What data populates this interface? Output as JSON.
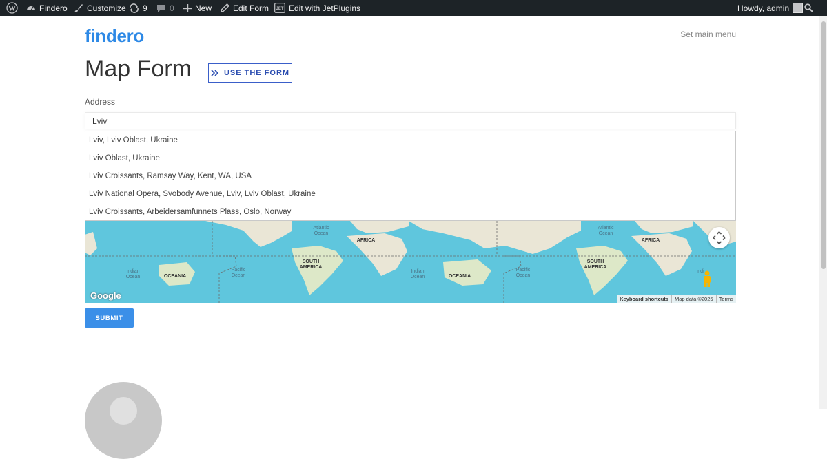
{
  "adminbar": {
    "site_name": "Findero",
    "customize": "Customize",
    "updates_count": "9",
    "comments_count": "0",
    "new_label": "New",
    "edit_form": "Edit Form",
    "jetplugins": "Edit with JetPlugins",
    "greeting": "Howdy, admin"
  },
  "header": {
    "logo": "findero",
    "menu": "Set main menu"
  },
  "page": {
    "title": "Map Form",
    "use_form_button": "USE THE FORM"
  },
  "form": {
    "address_label": "Address",
    "address_value": "Lviv",
    "suggestions": [
      "Lviv, Lviv Oblast, Ukraine",
      "Lviv Oblast, Ukraine",
      "Lviv Croissants, Ramsay Way, Kent, WA, USA",
      "Lviv National Opera, Svobody Avenue, Lviv, Lviv Oblast, Ukraine",
      "Lviv Croissants, Arbeidersamfunnets Plass, Oslo, Norway"
    ],
    "submit_label": "SUBMIT"
  },
  "map": {
    "labels": {
      "atlantic1": "Atlantic",
      "ocean1": "Ocean",
      "africa1": "AFRICA",
      "indian1": "Indian",
      "ocean2": "Ocean",
      "oceania1": "OCEANIA",
      "pacific1": "Pacific",
      "ocean3": "Ocean",
      "south1": "SOUTH",
      "america1": "AMERICA",
      "indian2": "Indian",
      "ocean4": "Ocean",
      "oceania2": "OCEANIA",
      "pacific2": "Pacific",
      "ocean5": "Ocean",
      "atlantic2": "Atlantic",
      "ocean6": "Ocean",
      "africa2": "AFRICA",
      "south2": "SOUTH",
      "america2": "AMERICA",
      "indian3": "Indi"
    },
    "google_logo": "Google",
    "attribution": {
      "shortcuts": "Keyboard shortcuts",
      "mapdata": "Map data ©2025",
      "terms": "Terms"
    }
  },
  "colors": {
    "accent": "#2d89e6",
    "button_blue": "#3b8fe8",
    "outline_button": "#3a5ec9",
    "adminbar_bg": "#1d2327",
    "water": "#5fc6dd",
    "land": "#eae6d6"
  },
  "icons": {
    "wp_logo": "wordpress-icon",
    "site": "dashboard-icon",
    "customize": "brush-icon",
    "updates": "refresh-icon",
    "comments": "comment-icon",
    "new": "plus-icon",
    "edit": "pencil-icon",
    "jet": "jet-icon",
    "search": "search-icon",
    "use_form": "double-chevron-icon",
    "fullscreen": "fullscreen-icon",
    "pegman": "pegman-icon"
  }
}
